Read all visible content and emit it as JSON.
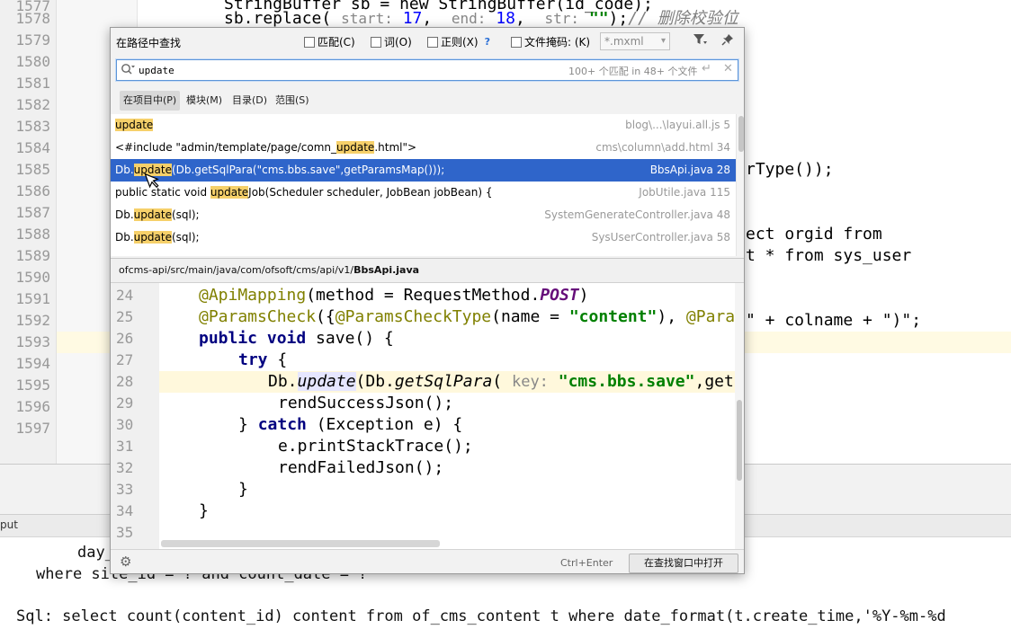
{
  "editor": {
    "line_numbers": [
      "1577",
      "1578",
      "1579",
      "1580",
      "1581",
      "1582",
      "1583",
      "1584",
      "1585",
      "1586",
      "1587",
      "1588",
      "1589",
      "1590",
      "1591",
      "1592",
      "1593",
      "1594",
      "1595",
      "1596",
      "1597"
    ],
    "line_1577": "StringBuffer sb = new StringBuffer(id_code);",
    "line_1578_pre": "sb.replace(",
    "line_1578_hint1": "start:",
    "line_1578_v1": "17",
    "line_1578_hint2": "end:",
    "line_1578_v2": "18",
    "line_1578_hint3": "str:",
    "line_1578_str": "\"\"",
    "line_1578_cmt": "// 删除校验位",
    "line_1585_tail": "rType());",
    "line_1588_tail": "ect orgid from",
    "line_1589_tail": "t * from sys_user",
    "line_1592_tail": "\" + colname + \")\";"
  },
  "run_panel": {
    "tab_label": "put",
    "console_lines": [
      "day_",
      "where site_id = ? and count_date = ?",
      "Sql: select count(content_id) content from of_cms_content t where date_format(t.create_time,'%Y-%m-%d"
    ]
  },
  "dialog": {
    "title": "在路径中查找",
    "options": {
      "match_case": "匹配(C)",
      "words": "词(O)",
      "regex": "正则(X)",
      "regex_help": "?",
      "file_mask": "文件掩码: (K)",
      "file_mask_value": "*.mxml"
    },
    "search": {
      "value": "update",
      "match_count": "100+ 个匹配 in 48+ 个文件"
    },
    "scopes": [
      "在项目中(P)",
      "模块(M)",
      "目录(D)",
      "范围(S)"
    ],
    "results": [
      {
        "pre": "",
        "hl": "update",
        "post": "",
        "file": "blog\\...\\layui.all.js 5"
      },
      {
        "pre": "<#include \"admin/template/page/comn_",
        "hl": "update",
        "post": ".html\">",
        "file": "cms\\column\\add.html 34"
      },
      {
        "pre": "Db.",
        "hl": "update",
        "post": "(Db.getSqlPara(\"cms.bbs.save\",getParamsMap()));",
        "file": "BbsApi.java 28"
      },
      {
        "pre": "public static void ",
        "hl": "update",
        "post": "Job(Scheduler scheduler, JobBean jobBean) {",
        "file": "JobUtile.java 115"
      },
      {
        "pre": "Db.",
        "hl": "update",
        "post": "(sql);",
        "file": "SystemGenerateController.java 48"
      },
      {
        "pre": "Db.",
        "hl": "update",
        "post": "(sql);",
        "file": "SysUserController.java 58"
      }
    ],
    "path_prefix": "ofcms-api/src/main/java/com/ofsoft/cms/api/v1/",
    "path_file": "BbsApi.java",
    "preview": {
      "line_numbers": [
        "24",
        "25",
        "26",
        "27",
        "28",
        "29",
        "30",
        "31",
        "32",
        "33",
        "34",
        "35"
      ],
      "l24_ann": "@ApiMapping",
      "l24_a": "(method = RequestMethod.",
      "l24_const": "POST",
      "l24_b": ")",
      "l25_ann": "@ParamsCheck",
      "l25_a": "({",
      "l25_ann2": "@ParamsCheckType",
      "l25_b": "(name = ",
      "l25_str": "\"content\"",
      "l25_c": "), ",
      "l25_ann3": "@Para",
      "l26_kw": "public void",
      "l26_a": " save() {",
      "l27_kw": "try",
      "l27_a": " {",
      "l28_a": "Db.",
      "l28_upd": "update",
      "l28_b": "(Db.",
      "l28_it": "getSqlPara",
      "l28_c": "( ",
      "l28_hint": "key:",
      "l28_str": " \"cms.bbs.save\"",
      "l28_d": ",getPa",
      "l29": "rendSuccessJson();",
      "l30_a": "} ",
      "l30_kw": "catch",
      "l30_b": " (Exception e) {",
      "l31": "e.printStackTrace();",
      "l32": "rendFailedJson();",
      "l33": "}",
      "l34": "}"
    },
    "footer": {
      "shortcut": "Ctrl+Enter",
      "open_button": "在查找窗口中打开"
    }
  },
  "icons": {
    "filter": "filter-icon",
    "pin": "pin-icon",
    "settings": "gear-icon"
  },
  "colors": {
    "selection": "#2f65ca",
    "highlight": "#f6d06a",
    "search_border": "#5d95d9"
  }
}
